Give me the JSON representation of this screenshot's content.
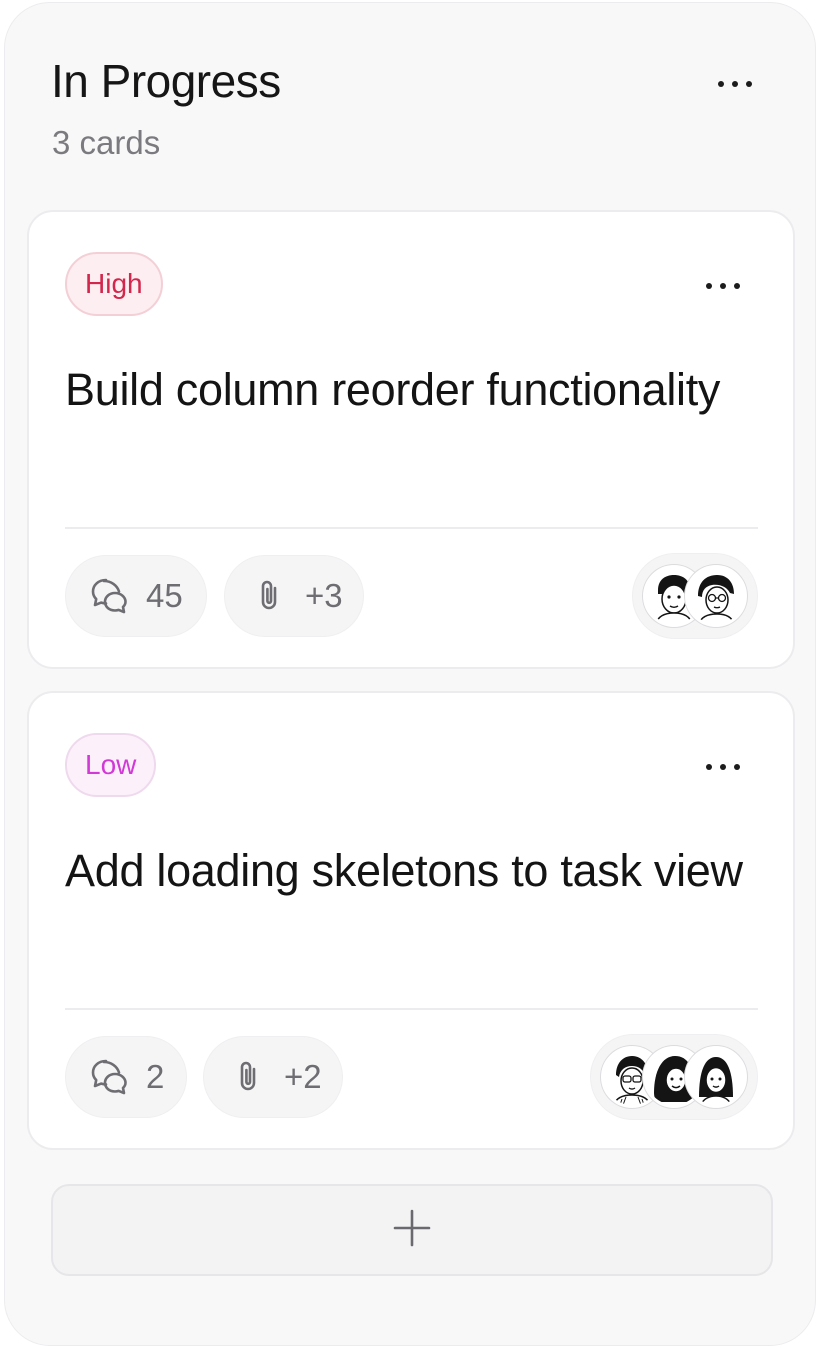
{
  "column": {
    "title": "In Progress",
    "count_label": "3 cards",
    "menu_icon": "more-horizontal-icon"
  },
  "cards": [
    {
      "priority": "High",
      "priority_color": "#d2264c",
      "title": "Build column reorder functionality",
      "comments": "45",
      "attachments": "+3",
      "avatar_count": 2
    },
    {
      "priority": "Low",
      "priority_color": "#d23ad6",
      "title": "Add loading skeletons to task view",
      "comments": "2",
      "attachments": "+2",
      "avatar_count": 3
    }
  ],
  "add_button": {
    "icon": "plus-icon"
  },
  "icons": {
    "comments": "comments-icon",
    "attachments": "paperclip-icon"
  }
}
